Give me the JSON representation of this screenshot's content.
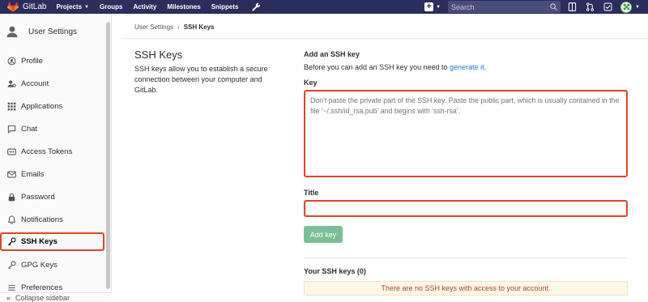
{
  "topbar": {
    "brand": "GitLab",
    "nav": [
      {
        "label": "Projects",
        "has_caret": true
      },
      {
        "label": "Groups",
        "has_caret": false
      },
      {
        "label": "Activity",
        "has_caret": false
      },
      {
        "label": "Milestones",
        "has_caret": false
      },
      {
        "label": "Snippets",
        "has_caret": false
      }
    ],
    "search_placeholder": "Search",
    "bg_color": "#2b2d5c"
  },
  "sidebar": {
    "title": "User Settings",
    "items": [
      {
        "label": "Profile",
        "icon": "profile-icon"
      },
      {
        "label": "Account",
        "icon": "account-icon"
      },
      {
        "label": "Applications",
        "icon": "applications-icon"
      },
      {
        "label": "Chat",
        "icon": "chat-icon"
      },
      {
        "label": "Access Tokens",
        "icon": "access-tokens-icon"
      },
      {
        "label": "Emails",
        "icon": "emails-icon"
      },
      {
        "label": "Password",
        "icon": "password-icon"
      },
      {
        "label": "Notifications",
        "icon": "notifications-icon"
      },
      {
        "label": "SSH Keys",
        "icon": "ssh-key-icon",
        "active": true
      },
      {
        "label": "GPG Keys",
        "icon": "gpg-key-icon"
      },
      {
        "label": "Preferences",
        "icon": "preferences-icon"
      }
    ],
    "collapse_label": "Collapse sidebar"
  },
  "breadcrumb": {
    "parent": "User Settings",
    "separator": "›",
    "current": "SSH Keys"
  },
  "intro": {
    "title": "SSH Keys",
    "description": "SSH keys allow you to establish a secure connection between your computer and GitLab."
  },
  "add_key": {
    "heading": "Add an SSH key",
    "desc_prefix": "Before you can add an SSH key you need to ",
    "desc_link": "generate it",
    "desc_suffix": ".",
    "key_label": "Key",
    "key_placeholder": "Don't paste the private part of the SSH key. Paste the public part, which is usually contained in the file '~/.ssh/id_rsa.pub' and begins with 'ssh-rsa'.",
    "title_label": "Title",
    "title_value": "",
    "submit_label": "Add key",
    "highlight_color": "#e24329"
  },
  "your_keys": {
    "heading": "Your SSH keys (0)",
    "empty_message": "There are no SSH keys with access to your account."
  }
}
